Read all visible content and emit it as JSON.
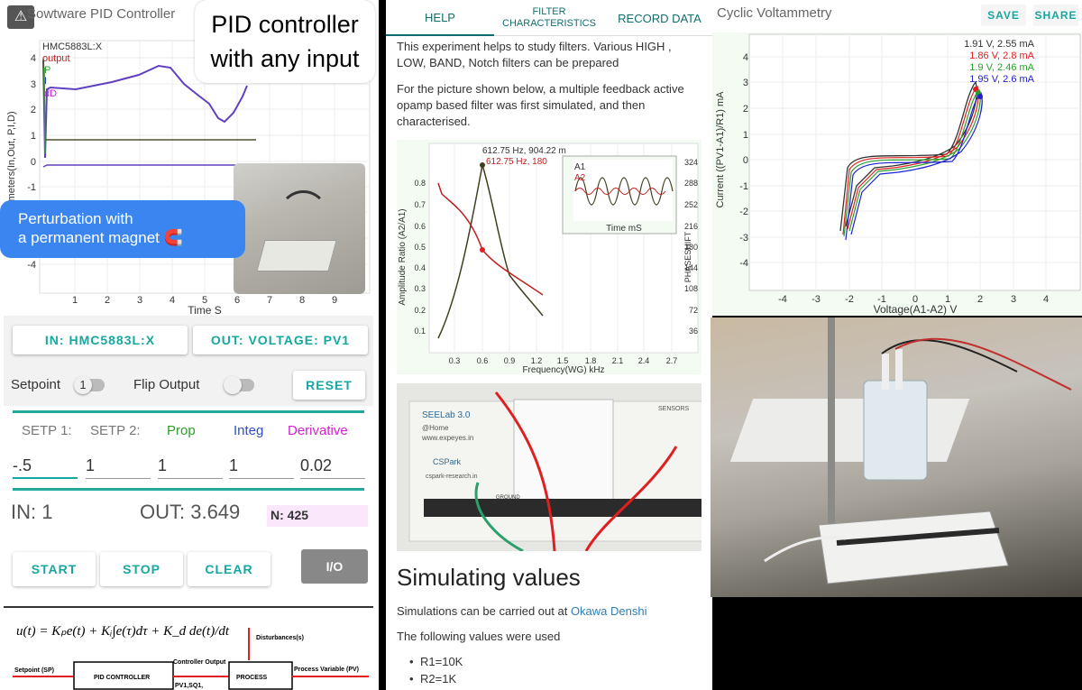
{
  "left": {
    "title": "Sowtware PID Controller",
    "warn_icon": "warning-icon",
    "pid_bubble": [
      "PID controller",
      "with any input"
    ],
    "blue_bubble": [
      "Perturbation with",
      "a permanent magnet 🧲"
    ],
    "chart": {
      "type": "line",
      "legend": [
        "HMC5883L:X",
        "output",
        "P",
        "I",
        "dD"
      ],
      "ylabel": "Parameters(In,Out, P,I,D)",
      "xlabel": "Time S",
      "yticks": [
        "4",
        "3",
        "2",
        "1",
        "0",
        "-1",
        "-2",
        "-3",
        "-4"
      ],
      "xticks": [
        "1",
        "2",
        "3",
        "4",
        "5",
        "6",
        "7",
        "8",
        "9"
      ]
    },
    "in_label": "IN: HMC5883L:X",
    "out_label": "OUT: VOLTAGE: PV1",
    "setpoint_label": "Setpoint",
    "setpoint_toggle": "1",
    "flip_label": "Flip Output",
    "reset_label": "RESET",
    "col_headers": [
      "SETP 1:",
      "SETP 2:",
      "Prop",
      "Integ",
      "Derivative"
    ],
    "values": [
      "-.5",
      "1",
      "1",
      "1",
      "0.02"
    ],
    "in_value": "IN: 1",
    "out_value": "OUT: 3.649",
    "n_value": "N: 425",
    "start_label": "START",
    "stop_label": "STOP",
    "clear_label": "CLEAR",
    "io_label": "I/O",
    "diagram": {
      "setpoint": "Setpoint (SP)",
      "controller": "PID CONTROLLER",
      "controller_output": "Controller Output",
      "output_pins": "PV1,SQ1,",
      "process": "PROCESS",
      "disturbance": "Disturbances(s)",
      "pv": "Process Variable (PV)"
    }
  },
  "middle": {
    "tabs": [
      "HELP",
      "FILTER CHARACTERISTICS",
      "RECORD DATA"
    ],
    "p1": "This experiment helps to study filters. Various HIGH , LOW, BAND, Notch filters can be prepared",
    "p2": "For the picture shown below, a multiple feedback active opamp based filter was first simulated, and then characterised.",
    "chart": {
      "type": "line",
      "ylabel": "Amplitude Ratio (A2/A1)",
      "ylabel2": "PHASESHIFT",
      "xlabel": "Frequency(WG) kHz",
      "annot1": "612.75 Hz, 904.22 m",
      "annot2": "612.75 Hz, 180",
      "yticks": [
        "0.8",
        "0.7",
        "0.6",
        "0.5",
        "0.4",
        "0.3",
        "0.2",
        "0.1"
      ],
      "yticks2": [
        "324",
        "288",
        "252",
        "216",
        "180",
        "144",
        "108",
        "72",
        "36"
      ],
      "xticks": [
        "0.3",
        "0.6",
        "0.9",
        "1.2",
        "1.5",
        "1.8",
        "2.1",
        "2.4",
        "2.7"
      ],
      "inset_legend": [
        "A1",
        "A2"
      ],
      "inset_xlabel": "Time mS"
    },
    "photo_text": {
      "brand": "SEELab 3.0",
      "home": "@Home",
      "site": "www.expeyes.in",
      "csp": "CSPark",
      "research": "cspark-research.in",
      "sensors": "SENSORS",
      "ground": "GROUND"
    },
    "h2": "Simulating values",
    "p3_pre": "Simulations can be carried out at ",
    "p3_link": "Okawa Denshi",
    "p4": "The following values were used",
    "bullets": [
      "R1=10K",
      "R2=1K"
    ]
  },
  "right": {
    "title": "Cyclic Voltammetry",
    "save_label": "SAVE",
    "share_label": "SHARE",
    "chart": {
      "type": "line",
      "ylabel": "Current ((PV1-A1)/R1) mA",
      "xlabel": "Voltage(A1-A2) V",
      "xticks": [
        "-4",
        "-3",
        "-2",
        "-1",
        "0",
        "1",
        "2",
        "3",
        "4"
      ],
      "yticks": [
        "4",
        "3",
        "2",
        "1",
        "0",
        "-1",
        "-2",
        "-3",
        "-4"
      ],
      "legend": [
        {
          "text": "1.91 V, 2.55 mA",
          "color": "#333333"
        },
        {
          "text": "1.86 V, 2.8 mA",
          "color": "#e02020"
        },
        {
          "text": "1.9 V, 2.46 mA",
          "color": "#2aa02a"
        },
        {
          "text": "1.95 V, 2.6 mA",
          "color": "#2020d0"
        }
      ]
    }
  },
  "colors": {
    "accent": "#15a8a0",
    "blue_bubble": "#3b85f0"
  }
}
